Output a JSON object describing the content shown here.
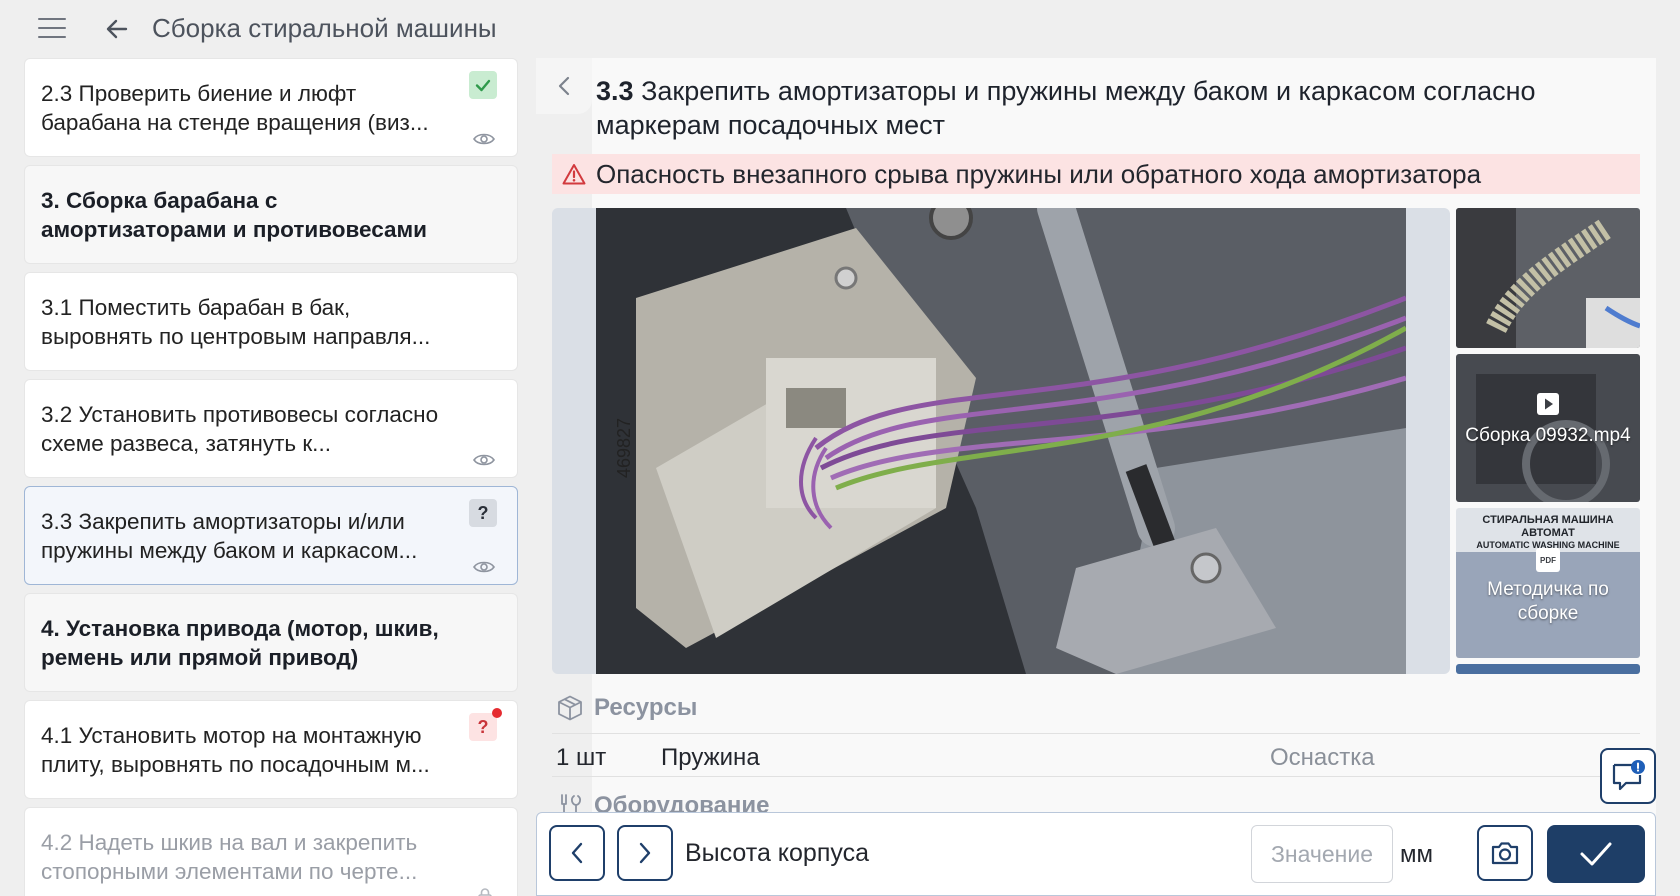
{
  "header": {
    "title": "Сборка стиральной машины"
  },
  "sidebar": {
    "items": [
      {
        "label": "2.3 Проверить биение и люфт барабана на стенде вращения (виз...",
        "status": "done"
      },
      {
        "label": "3. Сборка барабана с амортизаторами и противовесами",
        "status": "section"
      },
      {
        "label": "3.1 Поместить барабан в бак, выровнять по центровым направля...",
        "status": "none"
      },
      {
        "label": "3.2 Установить противовесы согласно схеме развеса, затянуть к...",
        "status": "none"
      },
      {
        "label": "3.3 Закрепить амортизаторы и/или пружины между баком и каркасом...",
        "status": "question"
      },
      {
        "label": "4. Установка привода (мотор, шкив, ремень или прямой привод)",
        "status": "section"
      },
      {
        "label": "4.1 Установить мотор на монтажную плиту, выровнять по посадочным м...",
        "status": "alert"
      },
      {
        "label": "4.2 Надеть шкив на вал и закрепить стопорными элементами по черте...",
        "status": "locked"
      }
    ],
    "badges": {
      "question": "?",
      "alert": "?"
    }
  },
  "step": {
    "number": "3.3",
    "title": "Закрепить амортизаторы и пружины между баком и каркасом согласно маркерам посадочных мест",
    "warning": "Опасность внезапного срыва пружины или обратного хода амортизатора"
  },
  "media": {
    "thumbnails": [
      {
        "type": "image",
        "label": ""
      },
      {
        "type": "video",
        "label": "Сборка 09932.mp4"
      },
      {
        "type": "pdf",
        "label": "Методичка по сборке",
        "doc_title": "СТИРАЛЬНАЯ МАШИНА АВТОМАТ",
        "doc_subtitle": "AUTOMATIC WASHING MACHINE",
        "pdf_tag": "PDF"
      }
    ],
    "photo_marking": "469827"
  },
  "resources": {
    "title": "Ресурсы",
    "items": [
      {
        "qty": "1 шт",
        "name": "Пружина",
        "type": "Оснастка"
      }
    ]
  },
  "equipment": {
    "title": "Оборудование"
  },
  "input_bar": {
    "param_label": "Высота корпуса",
    "value": "",
    "placeholder": "Значение",
    "unit": "мм"
  },
  "colors": {
    "accent": "#1e3e67",
    "warning_bg": "#fce3e3",
    "warning_icon": "#d23a3e",
    "done_badge": "#c9ecd1",
    "active_card_border": "#9fb6d6"
  },
  "icons": {
    "menu": "hamburger-icon",
    "back": "arrow-left-icon",
    "collapse": "chevron-left-icon",
    "warning": "warning-triangle-icon",
    "done": "check-icon",
    "view": "eye-icon",
    "lock": "lock-icon",
    "resources": "box-icon",
    "equipment": "tools-icon",
    "chat": "chat-alert-icon",
    "prev": "chevron-left-icon",
    "next": "chevron-right-icon",
    "camera": "camera-icon",
    "confirm": "check-icon"
  }
}
